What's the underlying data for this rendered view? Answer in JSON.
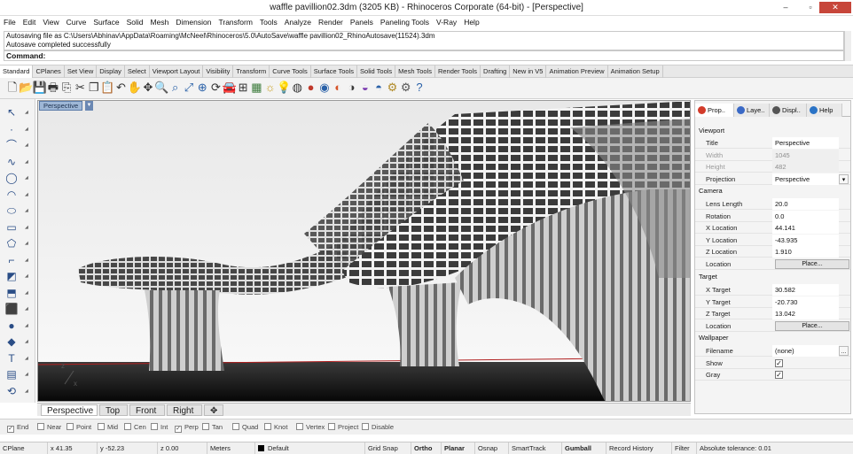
{
  "window": {
    "title": "waffle pavillion02.3dm (3205 KB) - Rhinoceros Corporate (64-bit) - [Perspective]",
    "controls": [
      "–",
      "▫",
      "✕"
    ]
  },
  "menu": [
    "File",
    "Edit",
    "View",
    "Curve",
    "Surface",
    "Solid",
    "Mesh",
    "Dimension",
    "Transform",
    "Tools",
    "Analyze",
    "Render",
    "Panels",
    "Paneling Tools",
    "V-Ray",
    "Help"
  ],
  "history": {
    "line1": "Autosaving file as C:\\Users\\Abhinav\\AppData\\Roaming\\McNeel\\Rhinoceros\\5.0\\AutoSave\\waffle pavillion02_RhinoAutosave(11524).3dm",
    "line2": "Autosave completed successfully"
  },
  "command": {
    "label": "Command:"
  },
  "toolbar_tabs": [
    "Standard",
    "CPlanes",
    "Set View",
    "Display",
    "Select",
    "Viewport Layout",
    "Visibility",
    "Transform",
    "Curve Tools",
    "Surface Tools",
    "Solid Tools",
    "Mesh Tools",
    "Render Tools",
    "Drafting",
    "New in V5",
    "Animation Preview",
    "Animation Setup"
  ],
  "toolbar_icons": [
    "new-file-icon",
    "open-icon",
    "save-icon",
    "print-icon",
    "import-icon",
    "cut-icon",
    "copy-icon",
    "paste-icon",
    "undo-icon",
    "pan-icon",
    "move-icon",
    "zoom-icon",
    "zoom-window-icon",
    "zoom-extents-icon",
    "zoom-selected-icon",
    "rotate-view-icon",
    "car-icon",
    "four-view-icon",
    "grid-icon",
    "lights-icon",
    "bulb-icon",
    "wire-icon",
    "shaded-icon",
    "render-icon",
    "color-wheel-icon",
    "ghosted-icon",
    "render-preview-icon",
    "material-icon",
    "settings-icon",
    "gear-icon",
    "help-icon"
  ],
  "left_tools": [
    "select-arrow-icon",
    "point-icon",
    "polyline-icon",
    "curve-icon",
    "circle-icon",
    "arc-icon",
    "ellipse-icon",
    "rectangle-icon",
    "polygon-icon",
    "fillet-icon",
    "surface-icon",
    "extrude-icon",
    "solid-box-icon",
    "sphere-icon",
    "mesh-icon",
    "text-icon",
    "cplane-icon",
    "transform-icon"
  ],
  "viewport": {
    "label": "Perspective",
    "axis_x": "x",
    "axis_z": "z"
  },
  "view_tabs": [
    "Perspective",
    "Top",
    "Front",
    "Right",
    "✥"
  ],
  "panel": {
    "tabs": [
      {
        "label": "Prop..",
        "color": "#d23b2a"
      },
      {
        "label": "Laye..",
        "color": "#3a69c6"
      },
      {
        "label": "Displ..",
        "color": "#555555"
      },
      {
        "label": "Help",
        "color": "#2a73c6"
      }
    ],
    "sections": {
      "viewport": "Viewport",
      "camera": "Camera",
      "target": "Target",
      "wallpaper": "Wallpaper"
    },
    "viewport_rows": [
      {
        "label": "Title",
        "value": "Perspective",
        "dim": false
      },
      {
        "label": "Width",
        "value": "1045",
        "dim": true
      },
      {
        "label": "Height",
        "value": "482",
        "dim": true
      },
      {
        "label": "Projection",
        "value": "Perspective",
        "dim": false
      }
    ],
    "camera_rows": [
      {
        "label": "Lens Length",
        "value": "20.0"
      },
      {
        "label": "Rotation",
        "value": "0.0"
      },
      {
        "label": "X Location",
        "value": "44.141"
      },
      {
        "label": "Y Location",
        "value": "-43.935"
      },
      {
        "label": "Z Location",
        "value": "1.910"
      },
      {
        "label": "Location",
        "button": "Place..."
      }
    ],
    "target_rows": [
      {
        "label": "X Target",
        "value": "30.582"
      },
      {
        "label": "Y Target",
        "value": "-20.730"
      },
      {
        "label": "Z Target",
        "value": "13.042"
      },
      {
        "label": "Location",
        "button": "Place..."
      }
    ],
    "wallpaper_rows": [
      {
        "label": "Filename",
        "value": "(none)"
      },
      {
        "label": "Show",
        "check": "✓"
      },
      {
        "label": "Gray",
        "check": "✓"
      }
    ]
  },
  "osnap": [
    {
      "label": "End",
      "checked": true
    },
    {
      "label": "Near",
      "checked": false
    },
    {
      "label": "Point",
      "checked": false
    },
    {
      "label": "Mid",
      "checked": false
    },
    {
      "label": "Cen",
      "checked": false
    },
    {
      "label": "Int",
      "checked": false
    },
    {
      "label": "Perp",
      "checked": true
    },
    {
      "label": "Tan",
      "checked": false
    },
    {
      "label": "Quad",
      "checked": false
    },
    {
      "label": "Knot",
      "checked": false
    },
    {
      "label": "Vertex",
      "checked": false
    },
    {
      "label": "Project",
      "checked": false
    },
    {
      "label": "Disable",
      "checked": false
    }
  ],
  "status": {
    "cplane": "CPlane",
    "x": "x 41.35",
    "y": "y -52.23",
    "z": "z 0.00",
    "units": "Meters",
    "layer": "Default",
    "grid_snap": "Grid Snap",
    "ortho": "Ortho",
    "planar": "Planar",
    "osnap": "Osnap",
    "smarttrack": "SmartTrack",
    "gumball": "Gumball",
    "record_history": "Record History",
    "filter": "Filter",
    "tolerance": "Absolute tolerance: 0.01"
  }
}
